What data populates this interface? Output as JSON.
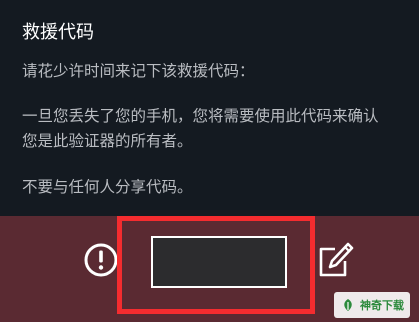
{
  "dialog": {
    "title": "救援代码",
    "instruction": "请花少许时间来记下该救援代码：",
    "warning_line1": "一旦您丢失了您的手机，您将需要使用此代码来确认",
    "warning_line2": "您是此验证器的所有者。",
    "share_note": "不要与任何人分享代码。"
  },
  "action_bar": {
    "background_color": "#5a2a32",
    "info_icon": "exclamation-circle-icon",
    "edit_icon": "pencil-edit-icon",
    "rescue_code": "",
    "highlight_color": "#f42c2f"
  },
  "watermark": {
    "text": "神奇下载",
    "icon": "leaf-logo-icon"
  }
}
